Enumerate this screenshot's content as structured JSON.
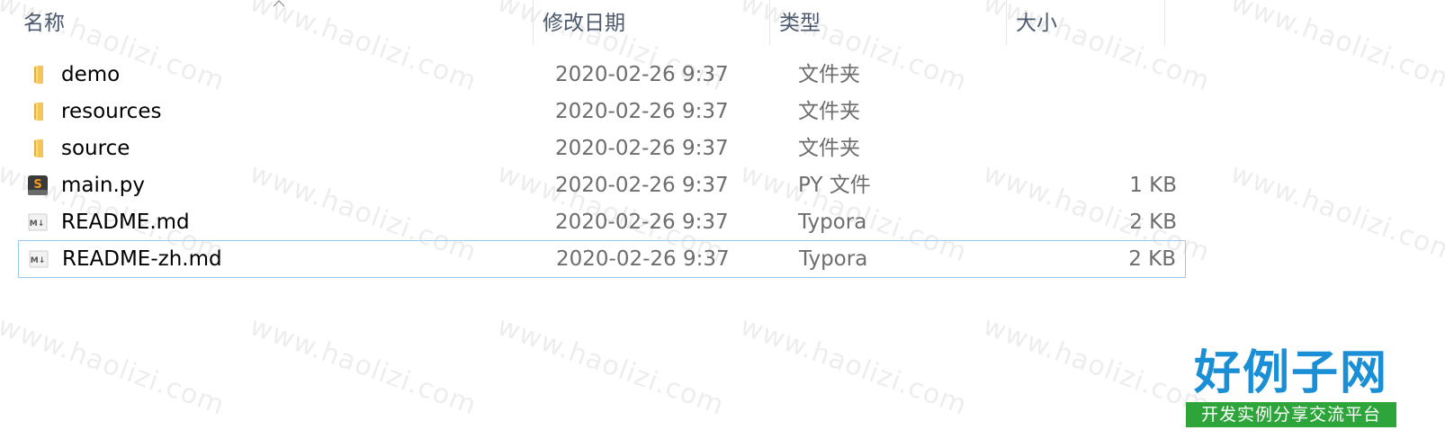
{
  "columns": {
    "name": "名称",
    "date": "修改日期",
    "type": "类型",
    "size": "大小"
  },
  "files": [
    {
      "name": "demo",
      "date": "2020-02-26 9:37",
      "type": "文件夹",
      "size": "",
      "icon": "folder-icon"
    },
    {
      "name": "resources",
      "date": "2020-02-26 9:37",
      "type": "文件夹",
      "size": "",
      "icon": "folder-icon"
    },
    {
      "name": "source",
      "date": "2020-02-26 9:37",
      "type": "文件夹",
      "size": "",
      "icon": "folder-icon"
    },
    {
      "name": "main.py",
      "date": "2020-02-26 9:37",
      "type": "PY 文件",
      "size": "1 KB",
      "icon": "sublime-file-icon"
    },
    {
      "name": "README.md",
      "date": "2020-02-26 9:37",
      "type": "Typora",
      "size": "2 KB",
      "icon": "markdown-file-icon"
    },
    {
      "name": "README-zh.md",
      "date": "2020-02-26 9:37",
      "type": "Typora",
      "size": "2 KB",
      "icon": "markdown-file-icon"
    }
  ],
  "selected_index": 5,
  "watermark": "www.haolizi.com",
  "logo": {
    "title": "好例子网",
    "subtitle": "开发实例分享交流平台"
  },
  "colors": {
    "header_text": "#4d5a6e",
    "meta_text": "#6d6d6d",
    "selection_border": "#99c9ef",
    "logo_blue": "#1a8fd6",
    "logo_green": "#2ea53a",
    "folder_yellow": "#f4c55a"
  }
}
